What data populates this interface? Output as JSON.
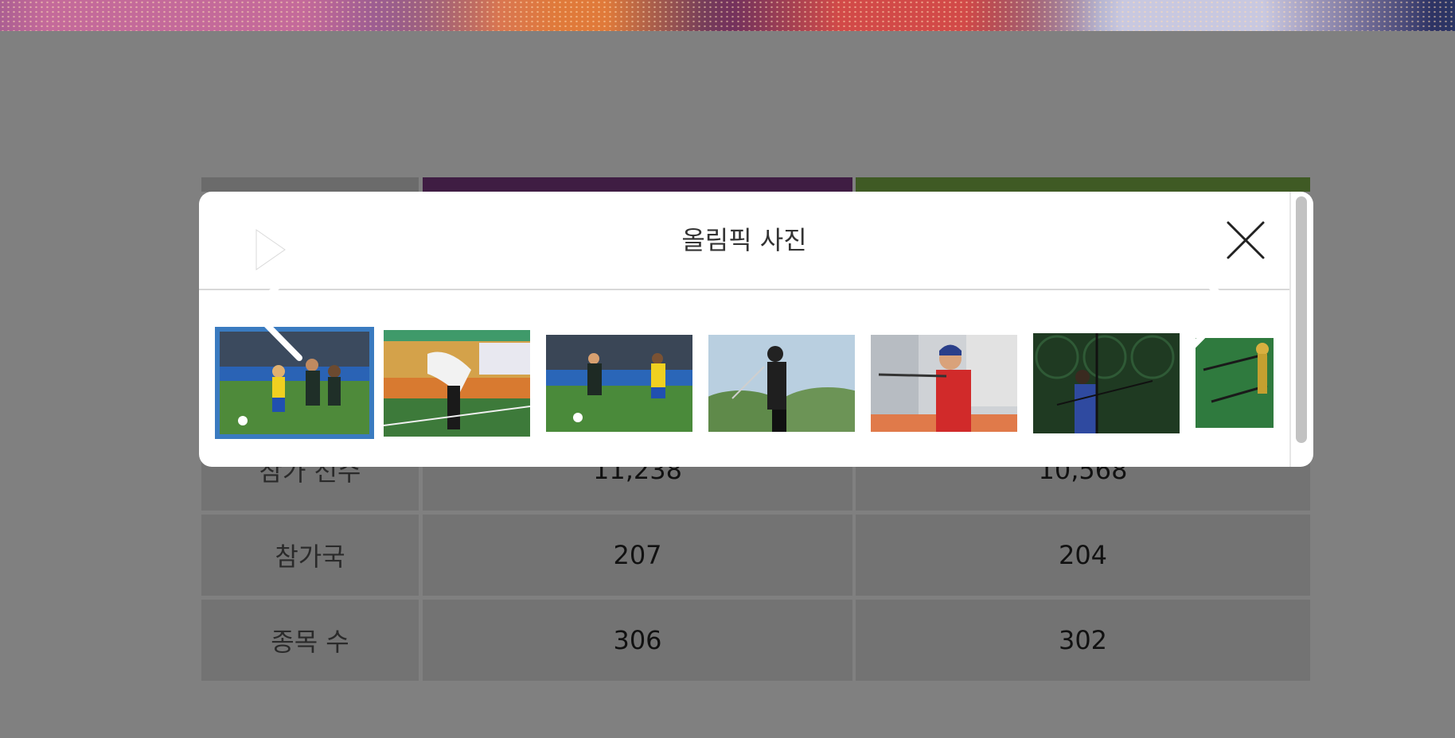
{
  "gallery": {
    "title": "올림픽 사진",
    "icons": {
      "play": "play-icon",
      "fullscreen": "fullscreen-icon",
      "close": "close-icon",
      "prev": "chevron-left-icon",
      "next": "chevron-right-icon"
    },
    "thumbnails": [
      {
        "subject": "soccer",
        "selected": true
      },
      {
        "subject": "photographer"
      },
      {
        "subject": "soccer"
      },
      {
        "subject": "golf"
      },
      {
        "subject": "golf"
      },
      {
        "subject": "archery"
      },
      {
        "subject": "archery"
      }
    ],
    "accent": "#3a7bc0"
  },
  "table": {
    "header_colors": [
      "#3f1d43",
      "#3f5a24"
    ],
    "rows": [
      {
        "label": "참가 선수",
        "a": "11,238",
        "b": "10,568"
      },
      {
        "label": "참가국",
        "a": "207",
        "b": "204"
      },
      {
        "label": "종목 수",
        "a": "306",
        "b": "302"
      }
    ]
  }
}
